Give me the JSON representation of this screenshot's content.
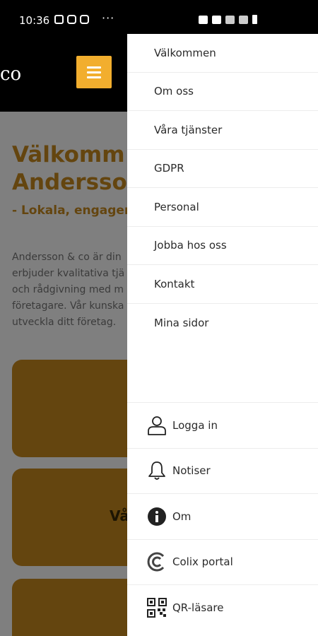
{
  "status_bar": {
    "time": "10:36",
    "dots": "···"
  },
  "app": {
    "logo_text": "co",
    "accent_color": "#f2ae2e",
    "hero_title_line1": "Välkomm",
    "hero_title_line2": "Andersso",
    "hero_subtitle": "- Lokala, engager",
    "intro_lines": [
      "Andersson & co är din",
      "erbjuder kvalitativa tjä",
      "och rådgivning med m",
      "företagare. Vår kunska",
      "utveckla ditt företag."
    ],
    "card2_label": "Vå"
  },
  "drawer": {
    "nav_items": [
      "Välkommen",
      "Om oss",
      "Våra tjänster",
      "GDPR",
      "Personal",
      "Jobba hos oss",
      "Kontakt",
      "Mina sidor"
    ],
    "bottom_items": [
      {
        "label": "Logga in",
        "icon": "user-icon"
      },
      {
        "label": "Notiser",
        "icon": "bell-icon"
      },
      {
        "label": "Om",
        "icon": "info-icon"
      },
      {
        "label": "Colix portal",
        "icon": "colix-icon"
      },
      {
        "label": "QR-läsare",
        "icon": "qr-code-icon"
      }
    ]
  }
}
